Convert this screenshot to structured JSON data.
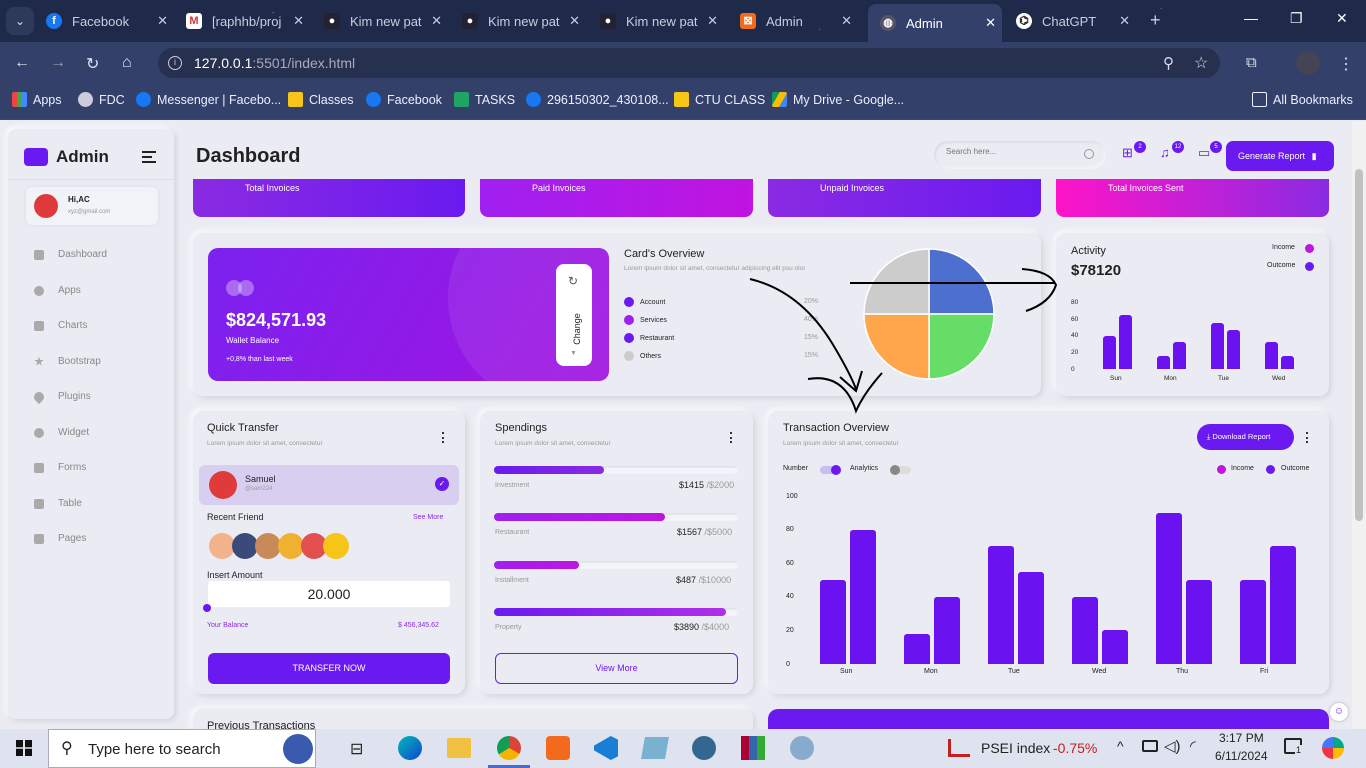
{
  "browser": {
    "tabs": [
      {
        "label": "Facebook",
        "icon": "facebook-icon"
      },
      {
        "label": "[raphhb/proj",
        "icon": "gmail-icon"
      },
      {
        "label": "Kim new pat",
        "icon": "github-icon"
      },
      {
        "label": "Kim new pat",
        "icon": "github-icon"
      },
      {
        "label": "Kim new pat",
        "icon": "github-icon"
      },
      {
        "label": "Admin",
        "icon": "xampp-icon"
      },
      {
        "label": "Admin",
        "icon": "globe-icon"
      },
      {
        "label": "ChatGPT",
        "icon": "chatgpt-icon"
      }
    ],
    "url_host": "127.0.0.1",
    "url_rest": ":5501/index.html",
    "bookmarks": [
      "Apps",
      "FDC",
      "Messenger | Facebo...",
      "Classes",
      "Facebook",
      "TASKS",
      "296150302_430108...",
      "CTU CLASS",
      "My Drive - Google..."
    ],
    "all_bookmarks": "All Bookmarks"
  },
  "sidebar": {
    "brand": "Admin",
    "user_name": "Hi,AC",
    "user_email": "xyz@gmail.com",
    "items": [
      "Dashboard",
      "Apps",
      "Charts",
      "Bootstrap",
      "Plugins",
      "Widget",
      "Forms",
      "Table",
      "Pages"
    ]
  },
  "header": {
    "title": "Dashboard",
    "search_placeholder": "Search here...",
    "badges": [
      "2",
      "12",
      "5"
    ],
    "generate_label": "Generate Report"
  },
  "stats": [
    "Total Invoices",
    "Paid Invoices",
    "Unpaid Invoices",
    "Total Invoices Sent"
  ],
  "wallet": {
    "balance": "$824,571.93",
    "label": "Wallet Balance",
    "note": "+0,8% than last week",
    "change_label": "Change"
  },
  "overview": {
    "title": "Card's Overview",
    "subtitle": "Lorem ipsum dolor sit amet, consectetur adipiscing elit psu olor",
    "items": [
      {
        "label": "Account",
        "pct": "20%"
      },
      {
        "label": "Services",
        "pct": "40%"
      },
      {
        "label": "Restaurant",
        "pct": "15%"
      },
      {
        "label": "Others",
        "pct": "15%"
      }
    ]
  },
  "activity": {
    "title": "Activity",
    "amount": "$78120",
    "income": "Income",
    "outcome": "Outcome"
  },
  "quick_transfer": {
    "title": "Quick Transfer",
    "subtitle": "Lorem ipsum dolor sit amet, consectetur",
    "name": "Samuel",
    "handle": "@sam224",
    "recent": "Recent Friend",
    "see_more": "See More",
    "insert": "Insert Amount",
    "amount": "20.000",
    "your_balance": "Your Balance",
    "balance_value": "$ 456,345.62",
    "button": "TRANSFER NOW"
  },
  "spendings": {
    "title": "Spendings",
    "subtitle": "Lorem ipsum dolor sit amet, consectetur",
    "items": [
      {
        "label": "Investment",
        "amount": "$1415",
        "total": "/$2000"
      },
      {
        "label": "Restaurant",
        "amount": "$1567",
        "total": "/$5000"
      },
      {
        "label": "Installment",
        "amount": "$487",
        "total": "/$10000"
      },
      {
        "label": "Property",
        "amount": "$3890",
        "total": "/$4000"
      }
    ],
    "view_more": "View More"
  },
  "transaction": {
    "title": "Transaction Overview",
    "subtitle": "Lorem ipsum dolor sit amet, consectetur",
    "download": "Download Report",
    "number": "Number",
    "analytics": "Analytics",
    "income": "Income",
    "outcome": "Outcome"
  },
  "bottom": {
    "prev": "Previous Transactions"
  },
  "taskbar": {
    "search": "Type here to search",
    "stock": "PSEI index",
    "stock_change": "-0.75%",
    "time": "3:17 PM",
    "date": "6/11/2024",
    "notif": "1"
  },
  "chart_data": [
    {
      "type": "pie",
      "labels": [
        "Account",
        "Services",
        "Restaurant",
        "Others"
      ],
      "values": [
        25,
        25,
        25,
        25
      ],
      "colors": [
        "#4c6fd0",
        "#66dd66",
        "#ffa64d",
        "#cccccc"
      ]
    },
    {
      "type": "bar",
      "categories": [
        "Sun",
        "Mon",
        "Tue",
        "Wed"
      ],
      "series": [
        {
          "name": "Income",
          "values": [
            40,
            15,
            55,
            32
          ]
        },
        {
          "name": "Outcome",
          "values": [
            65,
            32,
            47,
            15
          ]
        }
      ],
      "ylim": [
        0,
        80
      ],
      "ticks": [
        "0",
        "20",
        "40",
        "60",
        "80"
      ]
    },
    {
      "type": "bar",
      "categories": [
        "Sun",
        "Mon",
        "Tue",
        "Wed",
        "Thu",
        "Fri"
      ],
      "series": [
        {
          "name": "Income",
          "values": [
            50,
            18,
            70,
            40,
            90,
            50
          ]
        },
        {
          "name": "Outcome",
          "values": [
            80,
            40,
            55,
            20,
            50,
            70
          ]
        }
      ],
      "ylim": [
        0,
        100
      ],
      "ticks": [
        "0",
        "20",
        "40",
        "60",
        "80",
        "100"
      ]
    }
  ]
}
